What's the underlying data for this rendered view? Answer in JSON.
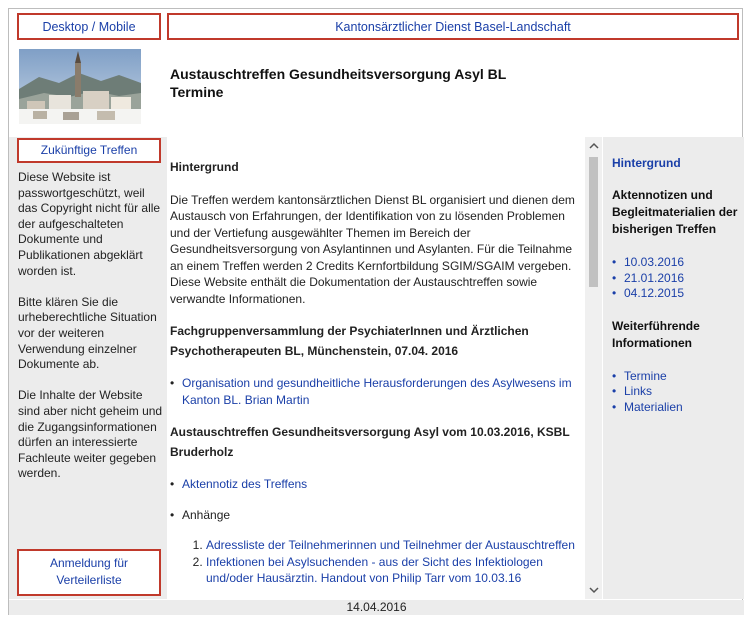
{
  "top_nav": {
    "desktop_mobile": "Desktop / Mobile",
    "kanton": "Kantonsärztlicher Dienst Basel-Landschaft"
  },
  "header": {
    "title_line1": "Austauschtreffen Gesundheitsversorgung Asyl BL",
    "title_line2": "Termine"
  },
  "left": {
    "future_meetings": "Zukünftige Treffen",
    "paragraphs": [
      "Diese Website ist passwortgeschützt, weil das Copyright nicht für alle der aufgeschalteten Dokumente und Publikationen abgeklärt worden ist.",
      "Bitte klären Sie die urheberechtliche Situation vor der weiteren Verwendung einzelner Dokumente ab.",
      "Die Inhalte der Website sind aber nicht geheim und die Zugangsinformationen dürfen an interessierte Fachleute weiter gegeben werden."
    ],
    "signup_line1": "Anmeldung für",
    "signup_line2": "Verteilerliste"
  },
  "main": {
    "h_background": "Hintergrund",
    "intro": "Die Treffen werdem kantonsärztlichen Dienst BL organisiert und dienen dem Austausch von Erfahrungen, der Identifikation von zu lösenden Problemen und der Vertiefung ausgewählter Themen im Bereich der Gesundheitsversorgung von Asylantinnen und Asylanten. Für die Teilnahme an einem Treffen werden 2 Credits Kernfortbildung SGIM/SGAIM vergeben. Diese Website enthält die Dokumentation der Austauschtreffen sowie verwandte Informationen.",
    "h_fachgruppe": "Fachgruppenversammlung der PsychiaterInnen und Ärztlichen Psychotherapeuten BL, Münchenstein, 07.04. 2016",
    "link_organisation": "Organisation und gesundheitliche Herausforderungen des Asylwesens im Kanton BL. Brian Martin",
    "h_austausch": "Austauschtreffen Gesundheitsversorgung Asyl vom 10.03.2016, KSBL Bruderholz",
    "link_aktennotiz": "Aktennotiz des Treffens",
    "anhaenge": "Anhänge",
    "attachments": [
      "Adressliste der Teilnehmerinnen und Teilnehmer der Austauschtreffen",
      "Infektionen bei Asylsuchenden - aus der Sicht des Infektiologen und/oder Hausärztin. Handout von Philip Tarr vom 10.03.16"
    ]
  },
  "right": {
    "h_background": "Hintergrund",
    "h_notes": "Aktennotizen und Begleitmaterialien der bisherigen Treffen",
    "dates": [
      "10.03.2016",
      "21.01.2016",
      "04.12.2015"
    ],
    "h_further": "Weiterführende Informationen",
    "links": [
      "Termine",
      "Links",
      "Materialien"
    ]
  },
  "footer": {
    "date": "14.04.2016"
  }
}
